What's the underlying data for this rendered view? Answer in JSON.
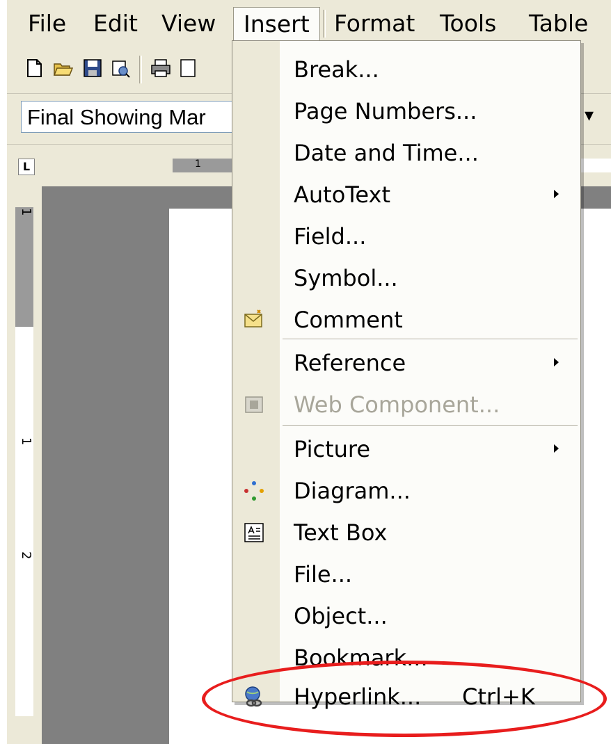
{
  "menubar": {
    "items": [
      {
        "label": "File"
      },
      {
        "label": "Edit"
      },
      {
        "label": "View"
      },
      {
        "label": "Insert"
      },
      {
        "label": "Format"
      },
      {
        "label": "Tools"
      },
      {
        "label": "Table"
      }
    ]
  },
  "toolbar": {
    "icons": [
      "new-document-icon",
      "open-folder-icon",
      "save-icon",
      "permission-icon",
      "print-icon",
      "print-preview-icon"
    ]
  },
  "formatting": {
    "style_value": "Final Showing Mar"
  },
  "ruler": {
    "h_number": "1",
    "v_numbers": [
      "1",
      "1",
      "2"
    ]
  },
  "insert_menu": {
    "items": [
      {
        "label": "Break...",
        "has_submenu": false
      },
      {
        "label": "Page Numbers...",
        "has_submenu": false
      },
      {
        "label": "Date and Time...",
        "has_submenu": false
      },
      {
        "label": "AutoText",
        "has_submenu": true
      },
      {
        "label": "Field...",
        "has_submenu": false
      },
      {
        "label": "Symbol...",
        "has_submenu": false
      },
      {
        "label": "Comment",
        "has_submenu": false,
        "icon": "comment-icon"
      },
      {
        "label": "Reference",
        "has_submenu": true
      },
      {
        "label": "Web Component...",
        "has_submenu": false,
        "disabled": true,
        "icon": "web-component-icon"
      },
      {
        "label": "Picture",
        "has_submenu": true
      },
      {
        "label": "Diagram...",
        "has_submenu": false,
        "icon": "diagram-icon"
      },
      {
        "label": "Text Box",
        "has_submenu": false,
        "icon": "text-box-icon"
      },
      {
        "label": "File...",
        "has_submenu": false
      },
      {
        "label": "Object...",
        "has_submenu": false
      },
      {
        "label": "Bookmark...",
        "has_submenu": false
      },
      {
        "label": "Hyperlink...",
        "shortcut": "Ctrl+K",
        "has_submenu": false,
        "icon": "hyperlink-icon",
        "highlighted": true
      }
    ]
  },
  "colors": {
    "chrome": "#ece9d8",
    "menu_bg": "#fcfcf9",
    "highlight_ellipse": "#e81d1d",
    "disabled_text": "#a8a69a"
  }
}
